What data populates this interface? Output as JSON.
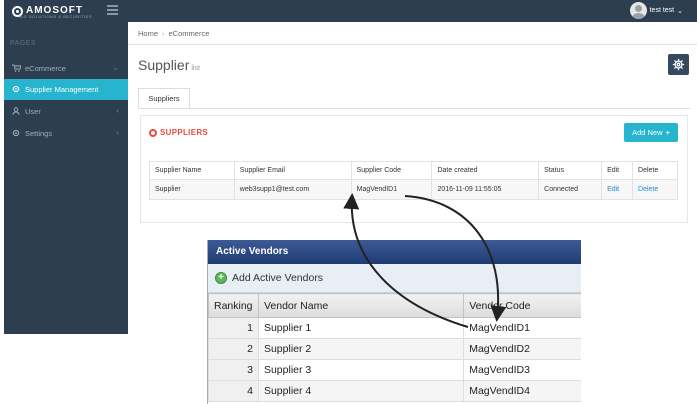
{
  "topbar": {
    "brand": "AMOSOFT",
    "brand_sub": "BIG SOLUTIONS & SECURITIES",
    "user_name": "test test",
    "caret": "⌄"
  },
  "sidebar": {
    "section_label": "PAGES",
    "items": [
      {
        "label": "eCommerce",
        "icon": "cart-icon",
        "chevron": "⌄",
        "active": false
      },
      {
        "label": "Supplier Management",
        "icon": "gear-icon",
        "chevron": "",
        "active": true
      },
      {
        "label": "User",
        "icon": "user-icon",
        "chevron": "‹",
        "active": false
      },
      {
        "label": "Settings",
        "icon": "gear-icon",
        "chevron": "‹",
        "active": false
      }
    ]
  },
  "breadcrumb": {
    "home": "Home",
    "sep": "›",
    "current": "eCommerce"
  },
  "page": {
    "title": "Supplier",
    "subtitle": "list"
  },
  "tabs": {
    "suppliers": "Suppliers"
  },
  "panel": {
    "title": "SUPPLIERS",
    "add_button": "Add New",
    "add_plus": "+"
  },
  "supplier_table": {
    "headers": [
      "Supplier Name",
      "Supplier Email",
      "Supplier Code",
      "Date created",
      "Status",
      "Edit",
      "Delete"
    ],
    "rows": [
      [
        "Supplier",
        "web3supp1@test.com",
        "MagVendID1",
        "2016-11-09 11:55:05",
        "Connected",
        "Edit",
        "Delete"
      ]
    ]
  },
  "vendors": {
    "title": "Active Vendors",
    "add_label": "Add Active Vendors",
    "headers": [
      "Ranking",
      "Vendor Name",
      "Vendor Code"
    ],
    "rows": [
      [
        "1",
        "Supplier 1",
        "MagVendID1"
      ],
      [
        "2",
        "Supplier 2",
        "MagVendID2"
      ],
      [
        "3",
        "Supplier 3",
        "MagVendID3"
      ],
      [
        "4",
        "Supplier 4",
        "MagVendID4"
      ]
    ]
  },
  "colors": {
    "sidebar": "#2c3e50",
    "accent": "#26b4ce",
    "danger": "#e74c3c",
    "link": "#2a8bd0",
    "vendor_header": "#2b4a84"
  }
}
